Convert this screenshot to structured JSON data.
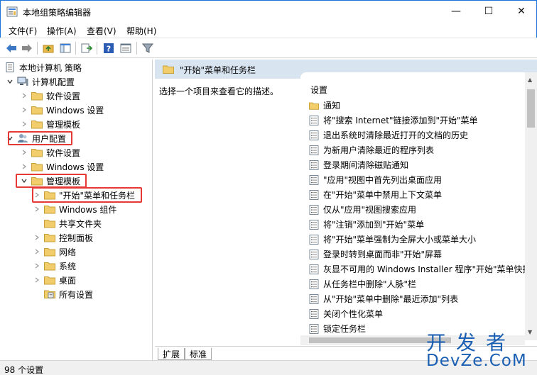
{
  "window": {
    "title": "本地组策略编辑器",
    "minimize": "—",
    "maximize": "☐",
    "close": "✕"
  },
  "menu": [
    "文件(F)",
    "操作(A)",
    "查看(V)",
    "帮助(H)"
  ],
  "toolbar": {
    "icons": [
      "back-arrow-icon",
      "forward-arrow-icon",
      "up-folder-icon",
      "show-hide-tree-icon",
      "export-list-icon",
      "help-icon",
      "properties-icon",
      "filter-icon"
    ]
  },
  "tree": {
    "root": "本地计算机 策略",
    "computer_config": "计算机配置",
    "software_settings_1": "软件设置",
    "windows_settings_1": "Windows 设置",
    "admin_templates_1": "管理模板",
    "user_config": "用户配置",
    "software_settings_2": "软件设置",
    "windows_settings_2": "Windows 设置",
    "admin_templates_2": "管理模板",
    "start_menu": "\"开始\"菜单和任务栏",
    "windows_components": "Windows 组件",
    "shared_folders": "共享文件夹",
    "control_panel": "控制面板",
    "network": "网络",
    "system": "系统",
    "desktop": "桌面",
    "all_settings": "所有设置"
  },
  "right_pane": {
    "header": "\"开始\"菜单和任务栏",
    "description": "选择一个项目来查看它的描述。",
    "column_header": "设置",
    "items": [
      "通知",
      "将\"搜索 Internet\"链接添加到\"开始\"菜单",
      "退出系统时清除最近打开的文档的历史",
      "为新用户清除最近的程序列表",
      "登录期间清除磁贴通知",
      "\"应用\"视图中首先列出桌面应用",
      "在\"开始\"菜单中禁用上下文菜单",
      "仅从\"应用\"视图搜索应用",
      "将\"注销\"添加到\"开始\"菜单",
      "将\"开始\"菜单强制为全屏大小或菜单大小",
      "登录时转到桌面而非\"开始\"屏幕",
      "灰显不可用的 Windows Installer 程序\"开始\"菜单快捷",
      "从任务栏中删除\"人脉\"栏",
      "从\"开始\"菜单中删除\"最近添加\"列表",
      "关闭个性化菜单",
      "锁定任务栏"
    ],
    "tabs": [
      "扩展",
      "标准"
    ]
  },
  "status": {
    "count": "98 个设置"
  },
  "watermark": {
    "line1": "开发者",
    "line2": "DevZe.CoM"
  },
  "colors": {
    "highlight_border": "#e53935",
    "header_bg": "#d9e4f1",
    "window_border": "#1a73d9",
    "folder": "#e8b94a"
  }
}
